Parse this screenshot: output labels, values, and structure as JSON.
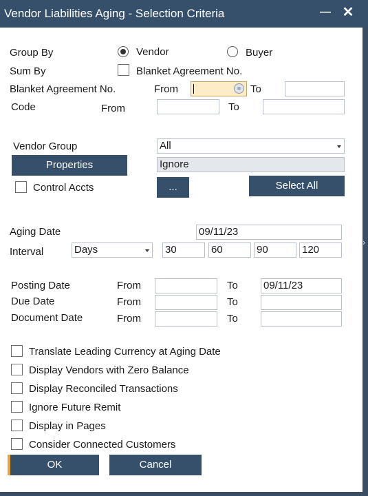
{
  "window": {
    "title": "Vendor Liabilities Aging - Selection Criteria",
    "minimize_icon": "minimize-icon",
    "close_icon": "close-icon"
  },
  "group_by": {
    "label": "Group By",
    "options": [
      {
        "label": "Vendor",
        "selected": true
      },
      {
        "label": "Buyer",
        "selected": false
      }
    ]
  },
  "sum_by": {
    "label": "Sum By",
    "checkbox_label": "Blanket Agreement No.",
    "checked": false
  },
  "blanket_agreement": {
    "label": "Blanket Agreement No.",
    "from_label": "From",
    "from_value": "",
    "to_label": "To",
    "to_value": ""
  },
  "code": {
    "label": "Code",
    "from_label": "From",
    "from_value": "",
    "to_label": "To",
    "to_value": ""
  },
  "vendor_group": {
    "label": "Vendor Group",
    "value": "All"
  },
  "properties": {
    "button_label": "Properties",
    "value": "Ignore"
  },
  "control_accts": {
    "label": "Control Accts",
    "checked": false,
    "more_button_label": "...",
    "select_all_label": "Select All"
  },
  "aging_date": {
    "label": "Aging Date",
    "value": "09/11/23"
  },
  "interval": {
    "label": "Interval",
    "unit": "Days",
    "values": [
      "30",
      "60",
      "90",
      "120"
    ]
  },
  "date_ranges": [
    {
      "label": "Posting Date",
      "from_label": "From",
      "from_value": "",
      "to_label": "To",
      "to_value": "09/11/23"
    },
    {
      "label": "Due Date",
      "from_label": "From",
      "from_value": "",
      "to_label": "To",
      "to_value": ""
    },
    {
      "label": "Document Date",
      "from_label": "From",
      "from_value": "",
      "to_label": "To",
      "to_value": ""
    }
  ],
  "options": [
    {
      "label": "Translate Leading Currency at Aging Date",
      "checked": false
    },
    {
      "label": "Display Vendors with Zero Balance",
      "checked": false
    },
    {
      "label": "Display Reconciled Transactions",
      "checked": false
    },
    {
      "label": "Ignore Future Remit",
      "checked": false
    },
    {
      "label": "Display in Pages",
      "checked": false
    },
    {
      "label": "Consider Connected Customers",
      "checked": false
    }
  ],
  "footer": {
    "ok_label": "OK",
    "cancel_label": "Cancel"
  },
  "colors": {
    "titlebar": "#36506b",
    "button": "#36506b",
    "focus_field": "#fdecc8",
    "ok_accent": "#e8a33a"
  }
}
